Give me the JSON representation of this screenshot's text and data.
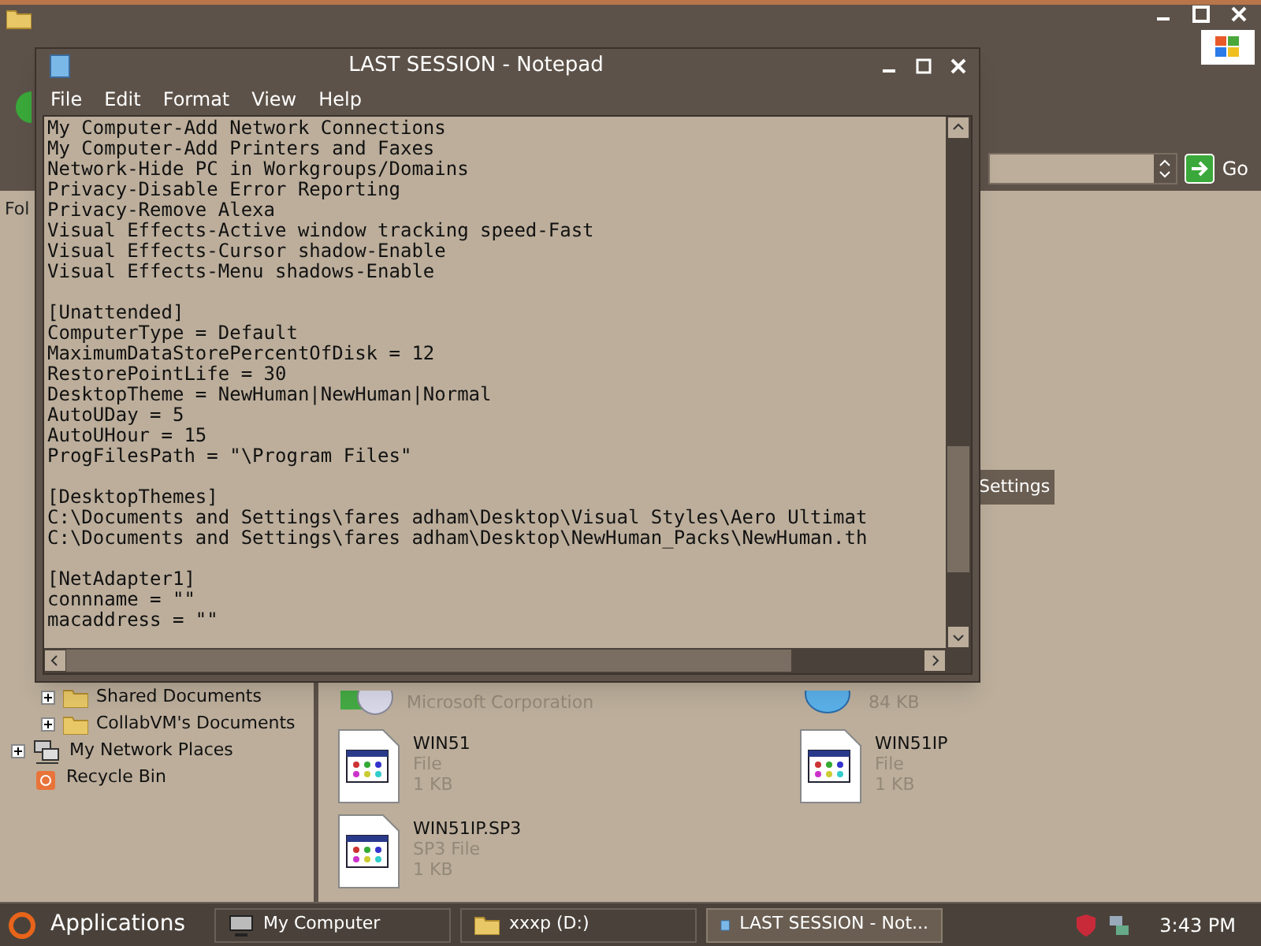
{
  "explorer": {
    "address_button": "Go",
    "folders_header": "Fol",
    "tree": [
      {
        "label": "Shared Documents",
        "kind": "folder",
        "expandable": true
      },
      {
        "label": "CollabVM's Documents",
        "kind": "folder",
        "expandable": true
      },
      {
        "label": "My Network Places",
        "kind": "network",
        "expandable": true
      },
      {
        "label": "Recycle Bin",
        "kind": "bin",
        "expandable": false
      }
    ],
    "side_items": [
      {
        "label": "Settings",
        "selected": true
      }
    ],
    "partial_row": [
      {
        "detail": "Microsoft Corporation",
        "kind": "cd"
      },
      {
        "detail": "84 KB",
        "kind": "globe"
      }
    ],
    "files": [
      {
        "name": "WIN51",
        "type": "File",
        "size": "1 KB"
      },
      {
        "name": "WIN51IP",
        "type": "File",
        "size": "1 KB"
      },
      {
        "name": "WIN51IP.SP3",
        "type": "SP3 File",
        "size": "1 KB"
      }
    ]
  },
  "notepad": {
    "title": "LAST SESSION - Notepad",
    "menu": [
      "File",
      "Edit",
      "Format",
      "View",
      "Help"
    ],
    "blocks": [
      [
        "My Computer-Add Network Connections",
        "My Computer-Add Printers and Faxes",
        "Network-Hide PC in Workgroups/Domains",
        "Privacy-Disable Error Reporting",
        "Privacy-Remove Alexa",
        "Visual Effects-Active window tracking speed-Fast",
        "Visual Effects-Cursor shadow-Enable",
        "Visual Effects-Menu shadows-Enable"
      ],
      [
        "[Unattended]",
        "ComputerType = Default",
        "MaximumDataStorePercentOfDisk = 12",
        "RestorePointLife = 30",
        "DesktopTheme = NewHuman|NewHuman|Normal",
        "AutoUDay = 5",
        "AutoUHour = 15",
        "ProgFilesPath = \"\\Program Files\""
      ],
      [
        "[DesktopThemes]",
        "C:\\Documents and Settings\\fares adham\\Desktop\\Visual Styles\\Aero Ultimat",
        "C:\\Documents and Settings\\fares adham\\Desktop\\NewHuman_Packs\\NewHuman.th"
      ],
      [
        "[NetAdapter1]",
        "connname = \"\"",
        "macaddress = \"\""
      ]
    ]
  },
  "taskbar": {
    "start": "Applications",
    "tasks": [
      {
        "label": "My Computer",
        "kind": "computer",
        "selected": false
      },
      {
        "label": "xxxp (D:)",
        "kind": "folder",
        "selected": false
      },
      {
        "label": "LAST SESSION - Not...",
        "kind": "notepad",
        "selected": true
      }
    ],
    "clock": "3:43 PM"
  }
}
